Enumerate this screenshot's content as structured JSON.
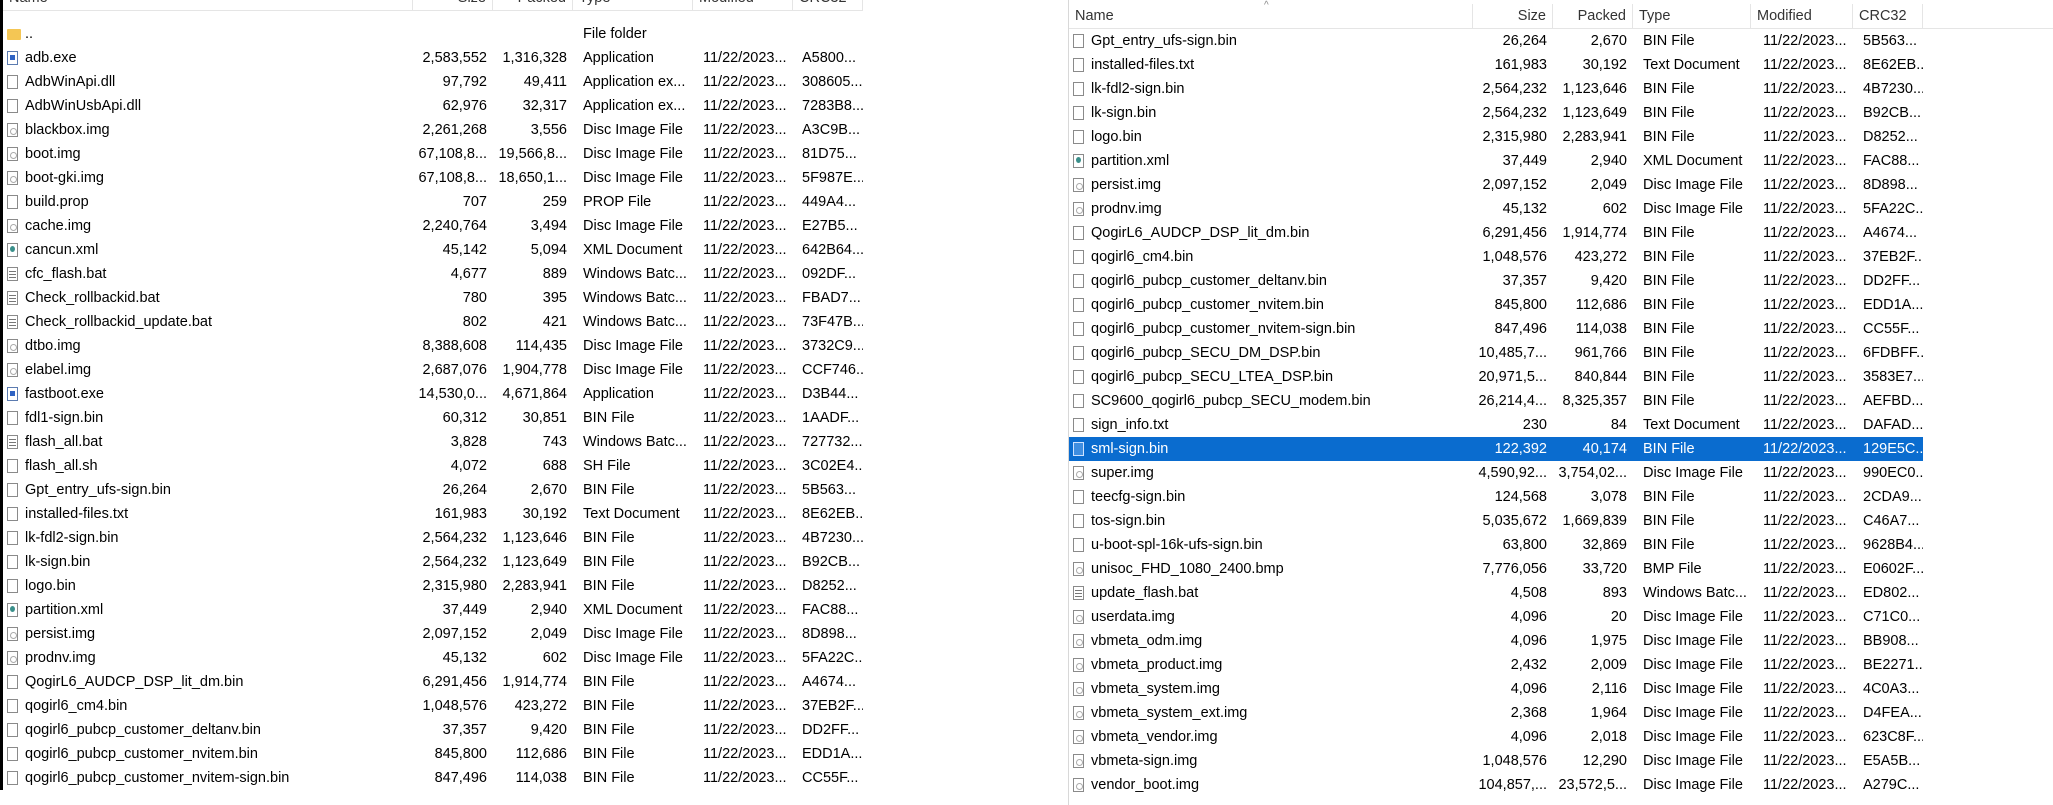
{
  "columns": {
    "name": "Name",
    "size": "Size",
    "packed": "Packed",
    "type": "Type",
    "modified": "Modified",
    "crc": "CRC32"
  },
  "left_pane": {
    "rows": [
      {
        "name": "..",
        "size": "",
        "packed": "",
        "type": "File folder",
        "modified": "",
        "crc": "",
        "icon": "folder-icon"
      },
      {
        "name": "adb.exe",
        "size": "2,583,552",
        "packed": "1,316,328",
        "type": "Application",
        "modified": "11/22/2023...",
        "crc": "A5800...",
        "icon": "exe-icon"
      },
      {
        "name": "AdbWinApi.dll",
        "size": "97,792",
        "packed": "49,411",
        "type": "Application ex...",
        "modified": "11/22/2023...",
        "crc": "308605...",
        "icon": "dll-icon"
      },
      {
        "name": "AdbWinUsbApi.dll",
        "size": "62,976",
        "packed": "32,317",
        "type": "Application ex...",
        "modified": "11/22/2023...",
        "crc": "7283B8...",
        "icon": "dll-icon"
      },
      {
        "name": "blackbox.img",
        "size": "2,261,268",
        "packed": "3,556",
        "type": "Disc Image File",
        "modified": "11/22/2023...",
        "crc": "A3C9B...",
        "icon": "disc-image-icon"
      },
      {
        "name": "boot.img",
        "size": "67,108,8...",
        "packed": "19,566,8...",
        "type": "Disc Image File",
        "modified": "11/22/2023...",
        "crc": "81D75...",
        "icon": "disc-image-icon"
      },
      {
        "name": "boot-gki.img",
        "size": "67,108,8...",
        "packed": "18,650,1...",
        "type": "Disc Image File",
        "modified": "11/22/2023...",
        "crc": "5F987E...",
        "icon": "disc-image-icon"
      },
      {
        "name": "build.prop",
        "size": "707",
        "packed": "259",
        "type": "PROP File",
        "modified": "11/22/2023...",
        "crc": "449A4...",
        "icon": "file-icon"
      },
      {
        "name": "cache.img",
        "size": "2,240,764",
        "packed": "3,494",
        "type": "Disc Image File",
        "modified": "11/22/2023...",
        "crc": "E27B5...",
        "icon": "disc-image-icon"
      },
      {
        "name": "cancun.xml",
        "size": "45,142",
        "packed": "5,094",
        "type": "XML Document",
        "modified": "11/22/2023...",
        "crc": "642B64...",
        "icon": "xml-icon"
      },
      {
        "name": "cfc_flash.bat",
        "size": "4,677",
        "packed": "889",
        "type": "Windows Batc...",
        "modified": "11/22/2023...",
        "crc": "092DF...",
        "icon": "batch-icon"
      },
      {
        "name": "Check_rollbackid.bat",
        "size": "780",
        "packed": "395",
        "type": "Windows Batc...",
        "modified": "11/22/2023...",
        "crc": "FBAD7...",
        "icon": "batch-icon"
      },
      {
        "name": "Check_rollbackid_update.bat",
        "size": "802",
        "packed": "421",
        "type": "Windows Batc...",
        "modified": "11/22/2023...",
        "crc": "73F47B...",
        "icon": "batch-icon"
      },
      {
        "name": "dtbo.img",
        "size": "8,388,608",
        "packed": "114,435",
        "type": "Disc Image File",
        "modified": "11/22/2023...",
        "crc": "3732C9...",
        "icon": "disc-image-icon"
      },
      {
        "name": "elabel.img",
        "size": "2,687,076",
        "packed": "1,904,778",
        "type": "Disc Image File",
        "modified": "11/22/2023...",
        "crc": "CCF746...",
        "icon": "disc-image-icon"
      },
      {
        "name": "fastboot.exe",
        "size": "14,530,0...",
        "packed": "4,671,864",
        "type": "Application",
        "modified": "11/22/2023...",
        "crc": "D3B44...",
        "icon": "exe-icon"
      },
      {
        "name": "fdl1-sign.bin",
        "size": "60,312",
        "packed": "30,851",
        "type": "BIN File",
        "modified": "11/22/2023...",
        "crc": "1AADF...",
        "icon": "file-icon"
      },
      {
        "name": "flash_all.bat",
        "size": "3,828",
        "packed": "743",
        "type": "Windows Batc...",
        "modified": "11/22/2023...",
        "crc": "727732...",
        "icon": "batch-icon"
      },
      {
        "name": "flash_all.sh",
        "size": "4,072",
        "packed": "688",
        "type": "SH File",
        "modified": "11/22/2023...",
        "crc": "3C02E4...",
        "icon": "file-icon"
      },
      {
        "name": "Gpt_entry_ufs-sign.bin",
        "size": "26,264",
        "packed": "2,670",
        "type": "BIN File",
        "modified": "11/22/2023...",
        "crc": "5B563...",
        "icon": "file-icon"
      },
      {
        "name": "installed-files.txt",
        "size": "161,983",
        "packed": "30,192",
        "type": "Text Document",
        "modified": "11/22/2023...",
        "crc": "8E62EB...",
        "icon": "file-icon"
      },
      {
        "name": "lk-fdl2-sign.bin",
        "size": "2,564,232",
        "packed": "1,123,646",
        "type": "BIN File",
        "modified": "11/22/2023...",
        "crc": "4B7230...",
        "icon": "file-icon"
      },
      {
        "name": "lk-sign.bin",
        "size": "2,564,232",
        "packed": "1,123,649",
        "type": "BIN File",
        "modified": "11/22/2023...",
        "crc": "B92CB...",
        "icon": "file-icon"
      },
      {
        "name": "logo.bin",
        "size": "2,315,980",
        "packed": "2,283,941",
        "type": "BIN File",
        "modified": "11/22/2023...",
        "crc": "D8252...",
        "icon": "file-icon"
      },
      {
        "name": "partition.xml",
        "size": "37,449",
        "packed": "2,940",
        "type": "XML Document",
        "modified": "11/22/2023...",
        "crc": "FAC88...",
        "icon": "xml-icon"
      },
      {
        "name": "persist.img",
        "size": "2,097,152",
        "packed": "2,049",
        "type": "Disc Image File",
        "modified": "11/22/2023...",
        "crc": "8D898...",
        "icon": "disc-image-icon"
      },
      {
        "name": "prodnv.img",
        "size": "45,132",
        "packed": "602",
        "type": "Disc Image File",
        "modified": "11/22/2023...",
        "crc": "5FA22C...",
        "icon": "disc-image-icon"
      },
      {
        "name": "QogirL6_AUDCP_DSP_lit_dm.bin",
        "size": "6,291,456",
        "packed": "1,914,774",
        "type": "BIN File",
        "modified": "11/22/2023...",
        "crc": "A4674...",
        "icon": "file-icon"
      },
      {
        "name": "qogirl6_cm4.bin",
        "size": "1,048,576",
        "packed": "423,272",
        "type": "BIN File",
        "modified": "11/22/2023...",
        "crc": "37EB2F...",
        "icon": "file-icon"
      },
      {
        "name": "qogirl6_pubcp_customer_deltanv.bin",
        "size": "37,357",
        "packed": "9,420",
        "type": "BIN File",
        "modified": "11/22/2023...",
        "crc": "DD2FF...",
        "icon": "file-icon"
      },
      {
        "name": "qogirl6_pubcp_customer_nvitem.bin",
        "size": "845,800",
        "packed": "112,686",
        "type": "BIN File",
        "modified": "11/22/2023...",
        "crc": "EDD1A...",
        "icon": "file-icon"
      },
      {
        "name": "qogirl6_pubcp_customer_nvitem-sign.bin",
        "size": "847,496",
        "packed": "114,038",
        "type": "BIN File",
        "modified": "11/22/2023...",
        "crc": "CC55F...",
        "icon": "file-icon"
      }
    ]
  },
  "right_pane": {
    "selected_name": "sml-sign.bin",
    "rows": [
      {
        "name": "Gpt_entry_ufs-sign.bin",
        "size": "26,264",
        "packed": "2,670",
        "type": "BIN File",
        "modified": "11/22/2023...",
        "crc": "5B563...",
        "icon": "file-icon"
      },
      {
        "name": "installed-files.txt",
        "size": "161,983",
        "packed": "30,192",
        "type": "Text Document",
        "modified": "11/22/2023...",
        "crc": "8E62EB...",
        "icon": "file-icon"
      },
      {
        "name": "lk-fdl2-sign.bin",
        "size": "2,564,232",
        "packed": "1,123,646",
        "type": "BIN File",
        "modified": "11/22/2023...",
        "crc": "4B7230...",
        "icon": "file-icon"
      },
      {
        "name": "lk-sign.bin",
        "size": "2,564,232",
        "packed": "1,123,649",
        "type": "BIN File",
        "modified": "11/22/2023...",
        "crc": "B92CB...",
        "icon": "file-icon"
      },
      {
        "name": "logo.bin",
        "size": "2,315,980",
        "packed": "2,283,941",
        "type": "BIN File",
        "modified": "11/22/2023...",
        "crc": "D8252...",
        "icon": "file-icon"
      },
      {
        "name": "partition.xml",
        "size": "37,449",
        "packed": "2,940",
        "type": "XML Document",
        "modified": "11/22/2023...",
        "crc": "FAC88...",
        "icon": "xml-icon"
      },
      {
        "name": "persist.img",
        "size": "2,097,152",
        "packed": "2,049",
        "type": "Disc Image File",
        "modified": "11/22/2023...",
        "crc": "8D898...",
        "icon": "disc-image-icon"
      },
      {
        "name": "prodnv.img",
        "size": "45,132",
        "packed": "602",
        "type": "Disc Image File",
        "modified": "11/22/2023...",
        "crc": "5FA22C...",
        "icon": "disc-image-icon"
      },
      {
        "name": "QogirL6_AUDCP_DSP_lit_dm.bin",
        "size": "6,291,456",
        "packed": "1,914,774",
        "type": "BIN File",
        "modified": "11/22/2023...",
        "crc": "A4674...",
        "icon": "file-icon"
      },
      {
        "name": "qogirl6_cm4.bin",
        "size": "1,048,576",
        "packed": "423,272",
        "type": "BIN File",
        "modified": "11/22/2023...",
        "crc": "37EB2F...",
        "icon": "file-icon"
      },
      {
        "name": "qogirl6_pubcp_customer_deltanv.bin",
        "size": "37,357",
        "packed": "9,420",
        "type": "BIN File",
        "modified": "11/22/2023...",
        "crc": "DD2FF...",
        "icon": "file-icon"
      },
      {
        "name": "qogirl6_pubcp_customer_nvitem.bin",
        "size": "845,800",
        "packed": "112,686",
        "type": "BIN File",
        "modified": "11/22/2023...",
        "crc": "EDD1A...",
        "icon": "file-icon"
      },
      {
        "name": "qogirl6_pubcp_customer_nvitem-sign.bin",
        "size": "847,496",
        "packed": "114,038",
        "type": "BIN File",
        "modified": "11/22/2023...",
        "crc": "CC55F...",
        "icon": "file-icon"
      },
      {
        "name": "qogirl6_pubcp_SECU_DM_DSP.bin",
        "size": "10,485,7...",
        "packed": "961,766",
        "type": "BIN File",
        "modified": "11/22/2023...",
        "crc": "6FDBFF...",
        "icon": "file-icon"
      },
      {
        "name": "qogirl6_pubcp_SECU_LTEA_DSP.bin",
        "size": "20,971,5...",
        "packed": "840,844",
        "type": "BIN File",
        "modified": "11/22/2023...",
        "crc": "3583E7...",
        "icon": "file-icon"
      },
      {
        "name": "SC9600_qogirl6_pubcp_SECU_modem.bin",
        "size": "26,214,4...",
        "packed": "8,325,357",
        "type": "BIN File",
        "modified": "11/22/2023...",
        "crc": "AEFBD...",
        "icon": "file-icon"
      },
      {
        "name": "sign_info.txt",
        "size": "230",
        "packed": "84",
        "type": "Text Document",
        "modified": "11/22/2023...",
        "crc": "DAFAD...",
        "icon": "file-icon"
      },
      {
        "name": "sml-sign.bin",
        "size": "122,392",
        "packed": "40,174",
        "type": "BIN File",
        "modified": "11/22/2023...",
        "crc": "129E5C...",
        "icon": "file-icon"
      },
      {
        "name": "super.img",
        "size": "4,590,92...",
        "packed": "3,754,02...",
        "type": "Disc Image File",
        "modified": "11/22/2023...",
        "crc": "990EC0...",
        "icon": "disc-image-icon"
      },
      {
        "name": "teecfg-sign.bin",
        "size": "124,568",
        "packed": "3,078",
        "type": "BIN File",
        "modified": "11/22/2023...",
        "crc": "2CDA9...",
        "icon": "file-icon"
      },
      {
        "name": "tos-sign.bin",
        "size": "5,035,672",
        "packed": "1,669,839",
        "type": "BIN File",
        "modified": "11/22/2023...",
        "crc": "C46A7...",
        "icon": "file-icon"
      },
      {
        "name": "u-boot-spl-16k-ufs-sign.bin",
        "size": "63,800",
        "packed": "32,869",
        "type": "BIN File",
        "modified": "11/22/2023...",
        "crc": "9628B4...",
        "icon": "file-icon"
      },
      {
        "name": "unisoc_FHD_1080_2400.bmp",
        "size": "7,776,056",
        "packed": "33,720",
        "type": "BMP File",
        "modified": "11/22/2023...",
        "crc": "E0602F...",
        "icon": "image-icon"
      },
      {
        "name": "update_flash.bat",
        "size": "4,508",
        "packed": "893",
        "type": "Windows Batc...",
        "modified": "11/22/2023...",
        "crc": "ED802...",
        "icon": "batch-icon"
      },
      {
        "name": "userdata.img",
        "size": "4,096",
        "packed": "20",
        "type": "Disc Image File",
        "modified": "11/22/2023...",
        "crc": "C71C0...",
        "icon": "disc-image-icon"
      },
      {
        "name": "vbmeta_odm.img",
        "size": "4,096",
        "packed": "1,975",
        "type": "Disc Image File",
        "modified": "11/22/2023...",
        "crc": "BB908...",
        "icon": "disc-image-icon"
      },
      {
        "name": "vbmeta_product.img",
        "size": "2,432",
        "packed": "2,009",
        "type": "Disc Image File",
        "modified": "11/22/2023...",
        "crc": "BE2271...",
        "icon": "disc-image-icon"
      },
      {
        "name": "vbmeta_system.img",
        "size": "4,096",
        "packed": "2,116",
        "type": "Disc Image File",
        "modified": "11/22/2023...",
        "crc": "4C0A3...",
        "icon": "disc-image-icon"
      },
      {
        "name": "vbmeta_system_ext.img",
        "size": "2,368",
        "packed": "1,964",
        "type": "Disc Image File",
        "modified": "11/22/2023...",
        "crc": "D4FEA...",
        "icon": "disc-image-icon"
      },
      {
        "name": "vbmeta_vendor.img",
        "size": "4,096",
        "packed": "2,018",
        "type": "Disc Image File",
        "modified": "11/22/2023...",
        "crc": "623C8F...",
        "icon": "disc-image-icon"
      },
      {
        "name": "vbmeta-sign.img",
        "size": "1,048,576",
        "packed": "12,290",
        "type": "Disc Image File",
        "modified": "11/22/2023...",
        "crc": "E5A5B...",
        "icon": "disc-image-icon"
      },
      {
        "name": "vendor_boot.img",
        "size": "104,857,...",
        "packed": "23,572,5...",
        "type": "Disc Image File",
        "modified": "11/22/2023...",
        "crc": "A279C...",
        "icon": "disc-image-icon"
      }
    ]
  },
  "colors": {
    "selection": "#0a6ccf",
    "header_divider": "#e5e5e5"
  }
}
